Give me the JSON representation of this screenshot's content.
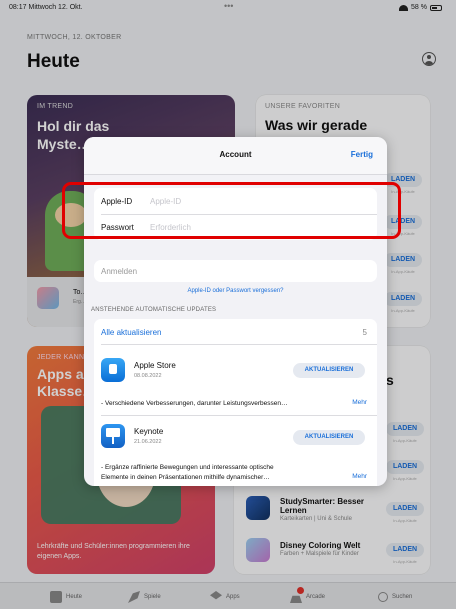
{
  "status_bar": {
    "time": "08:17",
    "date": "Mittwoch 12. Okt.",
    "battery": "58 %"
  },
  "today": {
    "date_label": "MITTWOCH, 12. OKTOBER",
    "title": "Heute"
  },
  "cards": {
    "trend": {
      "kicker": "IM TREND",
      "headline": "Hol dir das Myste…",
      "footer_title": "To…",
      "footer_sub": "Erg…"
    },
    "favorites": {
      "kicker": "UNSERE FAVORITEN",
      "headline": "Was wir gerade"
    },
    "class": {
      "kicker": "JEDER KANN",
      "headline": "Apps a… Klasse…",
      "footer_text": "Lehrkräfte und Schüler:innen programmieren ihre eigenen Apps."
    },
    "list": {
      "headline_fragment": "s",
      "apps": [
        {
          "title": "StudySmarter: Besser Lernen",
          "subtitle": "Karteikarten | Uni & Schule",
          "button": "LADEN",
          "note": "In-App-Käufe"
        },
        {
          "title": "Disney Coloring Welt",
          "subtitle": "Farben + Malspiele für Kinder",
          "button": "LADEN",
          "note": "In-App-Käufe"
        }
      ]
    }
  },
  "get_button_label": "LADEN",
  "in_app_label": "In-App-Käufe",
  "tab_bar": {
    "tabs": [
      "Heute",
      "Spiele",
      "Apps",
      "Arcade",
      "Suchen"
    ]
  },
  "account_modal": {
    "title": "Account",
    "done": "Fertig",
    "apple_id": {
      "label": "Apple-ID",
      "placeholder": "Apple-ID",
      "value": ""
    },
    "password": {
      "label": "Passwort",
      "placeholder": "Erforderlich",
      "value": ""
    },
    "sign_in": "Anmelden",
    "forgot": "Apple-ID oder Passwort vergessen?",
    "updates_header": "ANSTEHENDE AUTOMATISCHE UPDATES",
    "update_all": "Alle aktualisieren",
    "update_count": "5",
    "updates": [
      {
        "name": "Apple Store",
        "date": "08.08.2022",
        "button": "AKTUALISIEREN",
        "notes": "- Verschiedene Verbesserungen, darunter Leistungsverbessen…",
        "more": "Mehr"
      },
      {
        "name": "Keynote",
        "date": "21.06.2022",
        "button": "AKTUALISIEREN",
        "notes": "- Ergänze raffinierte Bewegungen und interessante optische",
        "notes2": "Elemente in deinen Präsentationen mithilfe dynamischer…",
        "more": "Mehr"
      }
    ]
  },
  "colors": {
    "accent": "#1a6fd9",
    "highlight": "#e00000",
    "arcade_badge": "#e0302a"
  }
}
